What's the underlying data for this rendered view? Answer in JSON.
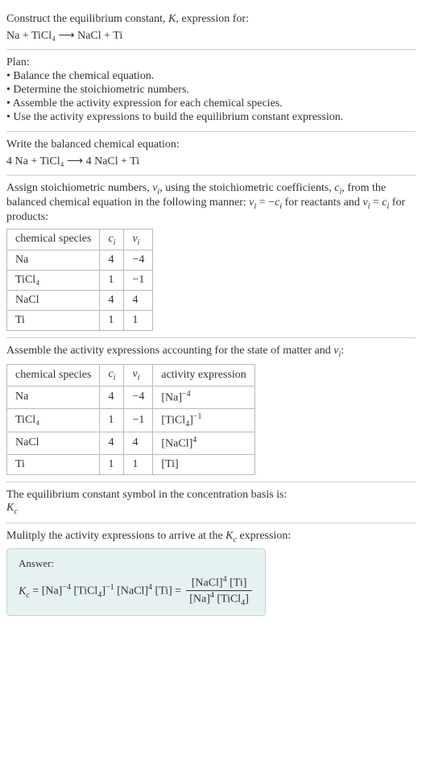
{
  "intro": {
    "line1": "Construct the equilibrium constant, K, expression for:",
    "equation": "Na + TiCl₄  ⟶  NaCl + Ti"
  },
  "plan": {
    "heading": "Plan:",
    "items": [
      "• Balance the chemical equation.",
      "• Determine the stoichiometric numbers.",
      "• Assemble the activity expression for each chemical species.",
      "• Use the activity expressions to build the equilibrium constant expression."
    ]
  },
  "balanced": {
    "text": "Write the balanced chemical equation:",
    "equation": "4 Na + TiCl₄  ⟶  4 NaCl + Ti"
  },
  "assign": {
    "text": "Assign stoichiometric numbers, νᵢ, using the stoichiometric coefficients, cᵢ, from the balanced chemical equation in the following manner: νᵢ = −cᵢ for reactants and νᵢ = cᵢ for products:",
    "headers": [
      "chemical species",
      "cᵢ",
      "νᵢ"
    ],
    "rows": [
      {
        "sp": "Na",
        "c": "4",
        "v": "−4"
      },
      {
        "sp": "TiCl₄",
        "c": "1",
        "v": "−1"
      },
      {
        "sp": "NaCl",
        "c": "4",
        "v": "4"
      },
      {
        "sp": "Ti",
        "c": "1",
        "v": "1"
      }
    ]
  },
  "assemble": {
    "text": "Assemble the activity expressions accounting for the state of matter and νᵢ:",
    "headers": [
      "chemical species",
      "cᵢ",
      "νᵢ",
      "activity expression"
    ],
    "rows": [
      {
        "sp": "Na",
        "c": "4",
        "v": "−4",
        "a": "[Na]⁻⁴"
      },
      {
        "sp": "TiCl₄",
        "c": "1",
        "v": "−1",
        "a": "[TiCl₄]⁻¹"
      },
      {
        "sp": "NaCl",
        "c": "4",
        "v": "4",
        "a": "[NaCl]⁴"
      },
      {
        "sp": "Ti",
        "c": "1",
        "v": "1",
        "a": "[Ti]"
      }
    ]
  },
  "symbol": {
    "text": "The equilibrium constant symbol in the concentration basis is:",
    "kc": "K_c"
  },
  "multiply": {
    "text": "Mulitply the activity expressions to arrive at the K_c expression:"
  },
  "answer": {
    "label": "Answer:",
    "lhs": "K_c = [Na]⁻⁴ [TiCl₄]⁻¹ [NaCl]⁴ [Ti] =",
    "num": "[NaCl]⁴ [Ti]",
    "den": "[Na]⁴ [TiCl₄]"
  }
}
